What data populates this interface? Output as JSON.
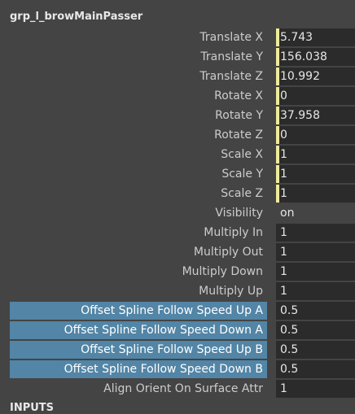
{
  "node_title": "grp_l_browMainPasser",
  "attributes": [
    {
      "label": "Translate X",
      "value": "5.743",
      "keyed": true
    },
    {
      "label": "Translate Y",
      "value": "156.038",
      "keyed": true
    },
    {
      "label": "Translate Z",
      "value": "10.992",
      "keyed": true
    },
    {
      "label": "Rotate X",
      "value": "0",
      "keyed": true
    },
    {
      "label": "Rotate Y",
      "value": "37.958",
      "keyed": true
    },
    {
      "label": "Rotate Z",
      "value": "0",
      "keyed": true
    },
    {
      "label": "Scale X",
      "value": "1",
      "keyed": true
    },
    {
      "label": "Scale Y",
      "value": "1",
      "keyed": true
    },
    {
      "label": "Scale Z",
      "value": "1",
      "keyed": true
    },
    {
      "label": "Visibility",
      "value": "on",
      "keyed": false,
      "plain": true
    },
    {
      "label": "Multiply In",
      "value": "1",
      "keyed": false
    },
    {
      "label": "Multiply Out",
      "value": "1",
      "keyed": false
    },
    {
      "label": "Multiply Down",
      "value": "1",
      "keyed": false
    },
    {
      "label": "Multiply Up",
      "value": "1",
      "keyed": false
    },
    {
      "label": "Offset Spline Follow Speed Up A",
      "value": "0.5",
      "keyed": false,
      "selected": true
    },
    {
      "label": "Offset Spline Follow Speed Down A",
      "value": "0.5",
      "keyed": false,
      "selected": true
    },
    {
      "label": "Offset Spline Follow Speed Up B",
      "value": "0.5",
      "keyed": false,
      "selected": true
    },
    {
      "label": "Offset Spline Follow Speed Down B",
      "value": "0.5",
      "keyed": false,
      "selected": true
    },
    {
      "label": "Align Orient On Surface Attr",
      "value": "1",
      "keyed": false
    }
  ],
  "next_section": "INPUTS",
  "colors": {
    "selected_label": "#5285a6",
    "keyed_marker": "#f0ea9c",
    "field_bg": "#2b2b2b",
    "panel_bg": "#444444"
  }
}
